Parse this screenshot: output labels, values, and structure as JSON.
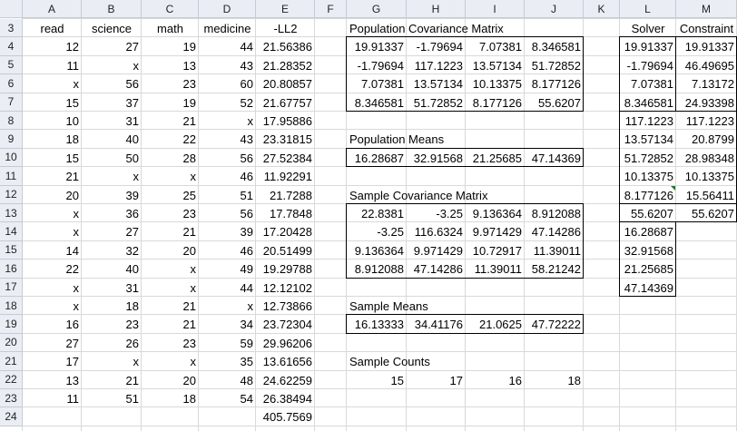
{
  "columns": [
    "A",
    "B",
    "C",
    "D",
    "E",
    "F",
    "G",
    "H",
    "I",
    "J",
    "K",
    "L",
    "M"
  ],
  "rows": [
    "3",
    "4",
    "5",
    "6",
    "7",
    "8",
    "9",
    "10",
    "11",
    "12",
    "13",
    "14",
    "15",
    "16",
    "17",
    "18",
    "19",
    "20",
    "21",
    "22",
    "23",
    "24"
  ],
  "data_table": {
    "headers": [
      "read",
      "science",
      "math",
      "medicine",
      "-LL2"
    ],
    "rows": [
      [
        "12",
        "27",
        "19",
        "44",
        "21.56386"
      ],
      [
        "11",
        "x",
        "13",
        "43",
        "21.28352"
      ],
      [
        "x",
        "56",
        "23",
        "60",
        "20.80857"
      ],
      [
        "15",
        "37",
        "19",
        "52",
        "21.67757"
      ],
      [
        "10",
        "31",
        "21",
        "x",
        "17.95886"
      ],
      [
        "18",
        "40",
        "22",
        "43",
        "23.31815"
      ],
      [
        "15",
        "50",
        "28",
        "56",
        "27.52384"
      ],
      [
        "21",
        "x",
        "x",
        "46",
        "11.92291"
      ],
      [
        "20",
        "39",
        "25",
        "51",
        "21.7288"
      ],
      [
        "x",
        "36",
        "23",
        "56",
        "17.7848"
      ],
      [
        "x",
        "27",
        "21",
        "39",
        "17.20428"
      ],
      [
        "14",
        "32",
        "20",
        "46",
        "20.51499"
      ],
      [
        "22",
        "40",
        "x",
        "49",
        "19.29788"
      ],
      [
        "x",
        "31",
        "x",
        "44",
        "12.12102"
      ],
      [
        "x",
        "18",
        "21",
        "x",
        "12.73866"
      ],
      [
        "16",
        "23",
        "21",
        "34",
        "23.72304"
      ],
      [
        "27",
        "26",
        "23",
        "59",
        "29.96206"
      ],
      [
        "17",
        "x",
        "x",
        "35",
        "13.61656"
      ],
      [
        "13",
        "21",
        "20",
        "48",
        "24.62259"
      ],
      [
        "11",
        "51",
        "18",
        "54",
        "26.38494"
      ]
    ],
    "total": "405.7569"
  },
  "pop_cov": {
    "title": "Population Covariance Matrix",
    "rows": [
      [
        "19.91337",
        "-1.79694",
        "7.07381",
        "8.346581"
      ],
      [
        "-1.79694",
        "117.1223",
        "13.57134",
        "51.72852"
      ],
      [
        "7.07381",
        "13.57134",
        "10.13375",
        "8.177126"
      ],
      [
        "8.346581",
        "51.72852",
        "8.177126",
        "55.6207"
      ]
    ]
  },
  "pop_means": {
    "title": "Population Means",
    "values": [
      "16.28687",
      "32.91568",
      "21.25685",
      "47.14369"
    ]
  },
  "sample_cov": {
    "title": "Sample Covariance Matrix",
    "rows": [
      [
        "22.8381",
        "-3.25",
        "9.136364",
        "8.912088"
      ],
      [
        "-3.25",
        "116.6324",
        "9.971429",
        "47.14286"
      ],
      [
        "9.136364",
        "9.971429",
        "10.72917",
        "11.39011"
      ],
      [
        "8.912088",
        "47.14286",
        "11.39011",
        "58.21242"
      ]
    ]
  },
  "sample_means": {
    "title": "Sample Means",
    "values": [
      "16.13333",
      "34.41176",
      "21.0625",
      "47.72222"
    ]
  },
  "sample_counts": {
    "title": "Sample Counts",
    "values": [
      "15",
      "17",
      "16",
      "18"
    ]
  },
  "solver": {
    "header": "Solver",
    "values": [
      "19.91337",
      "-1.79694",
      "7.07381",
      "8.346581",
      "117.1223",
      "13.57134",
      "51.72852",
      "10.13375",
      "8.177126",
      "55.6207",
      "16.28687",
      "32.91568",
      "21.25685",
      "47.14369"
    ]
  },
  "constraint": {
    "header": "Constraint",
    "values": [
      "19.91337",
      "46.49695",
      "7.13172",
      "24.93398",
      "117.1223",
      "20.8799",
      "28.98348",
      "10.13375",
      "15.56411",
      "55.6207"
    ]
  },
  "colors": {
    "header_bg": "#eaeef4",
    "gridline": "#d9d9d9",
    "border": "#000000",
    "comment_marker": "#1f7a1f"
  }
}
